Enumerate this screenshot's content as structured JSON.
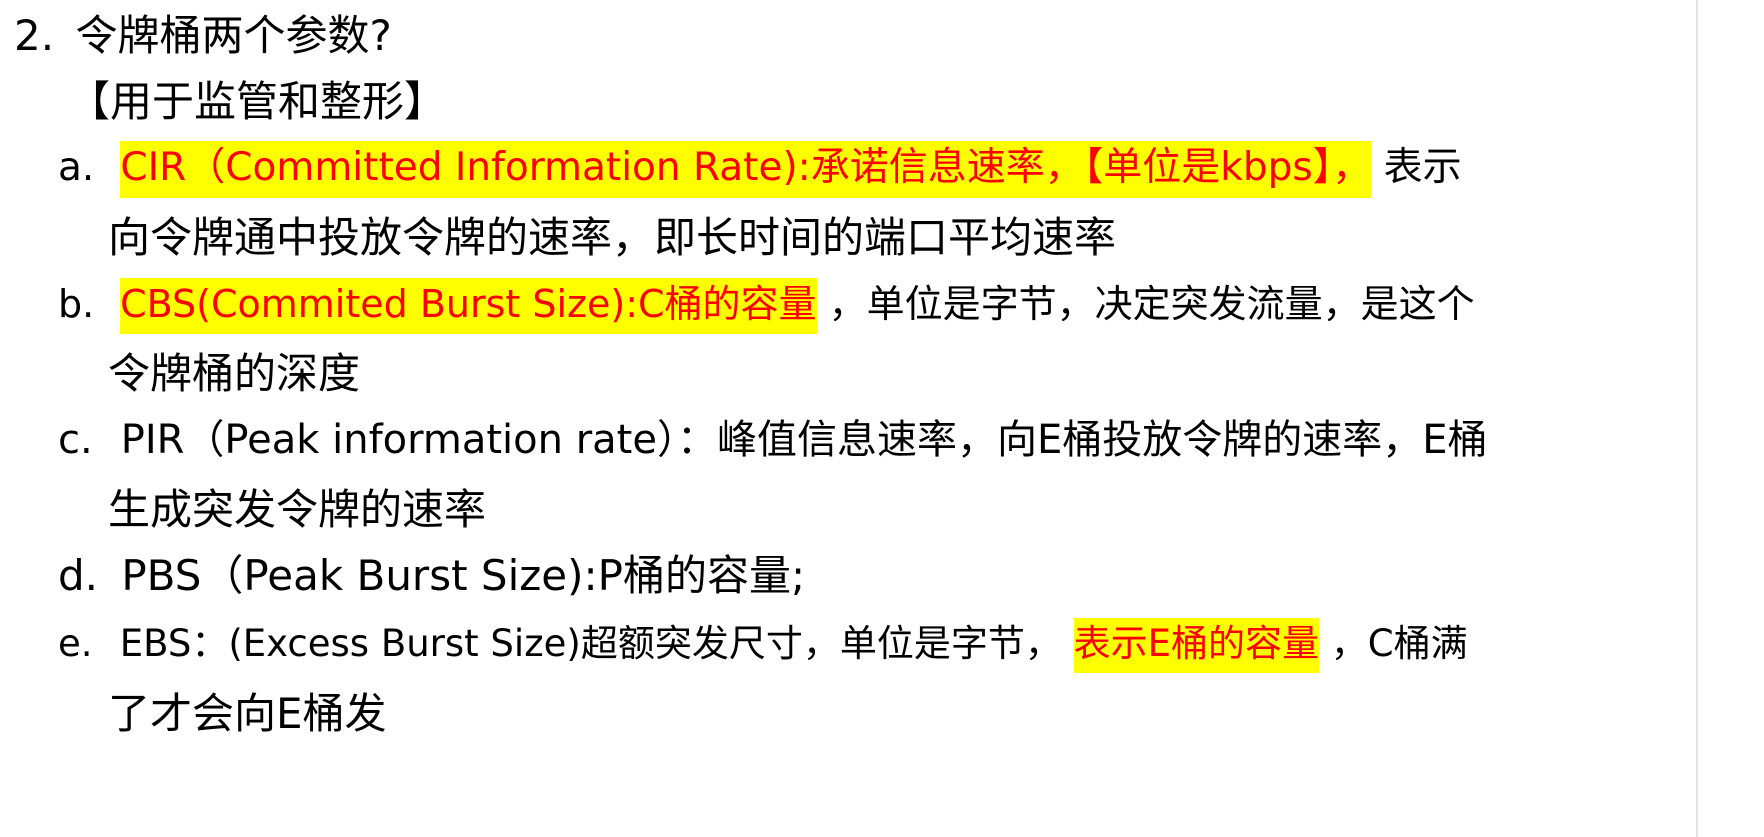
{
  "heading": {
    "number": "2.",
    "text": "令牌桶两个参数?"
  },
  "subheading": "【用于监管和整形】",
  "items": [
    {
      "marker": "a.",
      "highlight": "CIR（Committed Information Rate):承诺信息速率，【单位是kbps】，",
      "after": "表示",
      "line2": "向令牌通中投放令牌的速率，即长时间的端口平均速率"
    },
    {
      "marker": "b.",
      "highlight": "CBS(Commited Burst Size):C桶的容量",
      "after": "，单位是字节，决定突发流量，是这个",
      "line2": "令牌桶的深度"
    },
    {
      "marker": "c.",
      "text": "PIR（Peak information rate）：峰值信息速率，向E桶投放令牌的速率，E桶",
      "line2": "生成突发令牌的速率"
    },
    {
      "marker": "d.",
      "text": "PBS（Peak Burst Size):P桶的容量;"
    },
    {
      "marker": "e.",
      "before": "EBS：(Excess Burst Size)超额突发尺寸，单位是字节，",
      "highlight": "表示E桶的容量",
      "after": "，C桶满",
      "line2": "了才会向E桶发"
    }
  ],
  "colors": {
    "highlight_bg": "#ffff00",
    "highlight_text": "#ff0000",
    "text": "#000000"
  }
}
